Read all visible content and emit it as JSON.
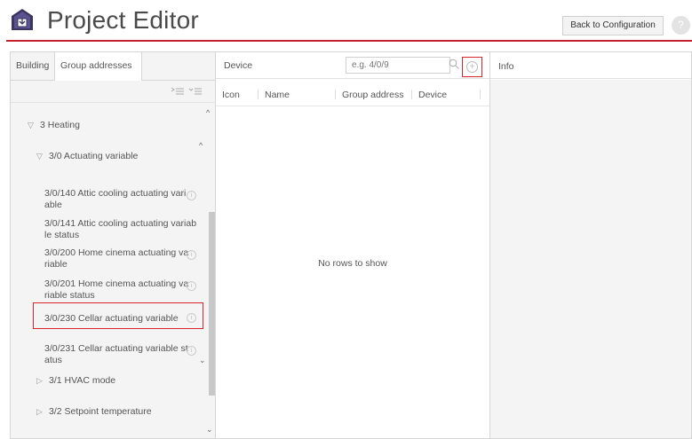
{
  "header": {
    "title": "Project Editor",
    "back_button": "Back to Configuration",
    "help": "?"
  },
  "colors": {
    "accent": "#c4202e",
    "highlight": "#d8262f"
  },
  "left_panel": {
    "tabs": [
      "Building",
      "Group addresses"
    ],
    "tree": [
      {
        "label": "3 Heating",
        "expander": "▽"
      },
      {
        "label": "3/0 Actuating variable",
        "expander": "▽"
      },
      {
        "label_lines": [
          "3/0/140 Attic cooling actuating vari",
          "able"
        ],
        "info": "i"
      },
      {
        "label_lines": [
          "3/0/141 Attic cooling actuating variab",
          "le status"
        ]
      },
      {
        "label_lines": [
          "3/0/200 Home cinema actuating va",
          "riable"
        ],
        "info": "i"
      },
      {
        "label_lines": [
          "3/0/201 Home cinema actuating va",
          "riable status"
        ],
        "info": "i"
      },
      {
        "label": "3/0/230 Cellar actuating variable",
        "info": "i",
        "selected": true
      },
      {
        "label_lines": [
          "3/0/231 Cellar actuating variable st",
          "atus"
        ],
        "info": "i"
      },
      {
        "label": "3/1 HVAC mode",
        "expander": "▷"
      },
      {
        "label": "3/2 Setpoint temperature",
        "expander": "▷"
      }
    ]
  },
  "middle_panel": {
    "title": "Device",
    "search_placeholder": "e.g. 4/0/9",
    "columns": [
      "Icon",
      "Name",
      "Group address",
      "Device"
    ],
    "empty_message": "No rows to show"
  },
  "right_panel": {
    "title": "Info"
  }
}
